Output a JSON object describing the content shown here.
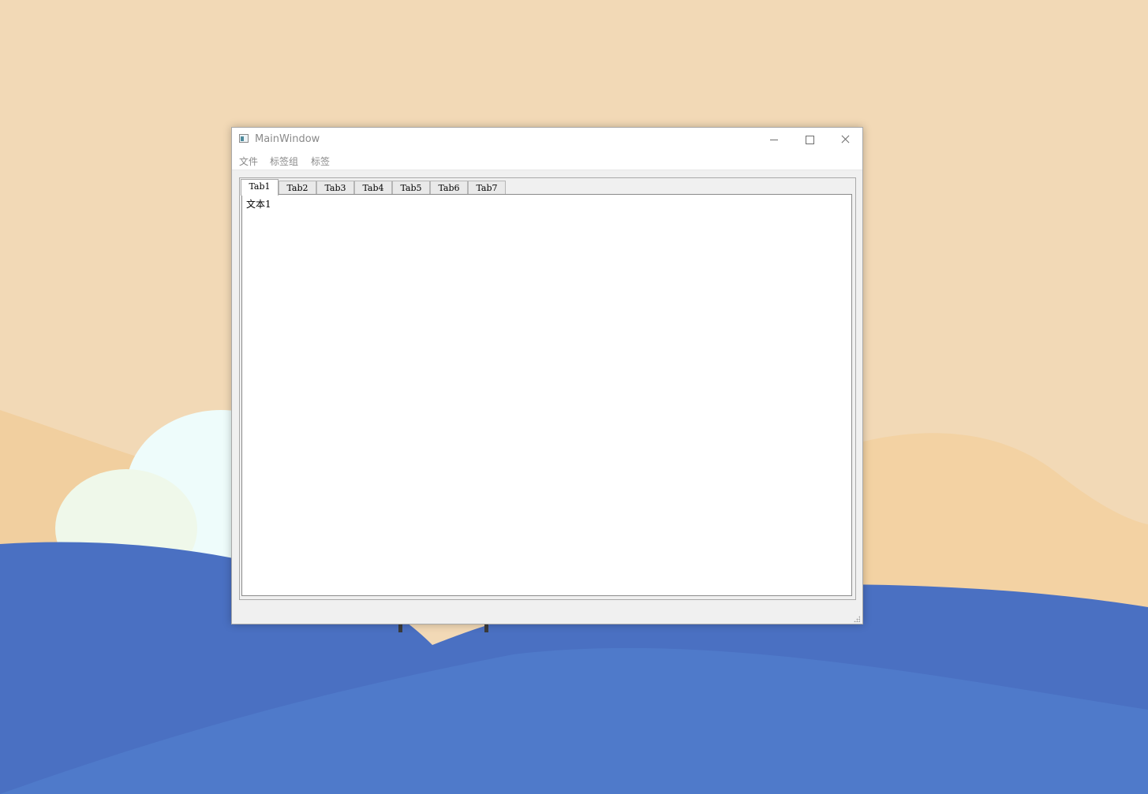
{
  "window": {
    "title": "MainWindow",
    "icon": "app-window-icon",
    "controls": [
      "minimize-icon",
      "maximize-icon",
      "close-icon"
    ]
  },
  "menubar": {
    "items": [
      {
        "label": "文件"
      },
      {
        "label": "标签组"
      },
      {
        "label": "标签"
      }
    ]
  },
  "tabs": {
    "items": [
      {
        "label": "Tab1",
        "active": true
      },
      {
        "label": "Tab2",
        "active": false
      },
      {
        "label": "Tab3",
        "active": false
      },
      {
        "label": "Tab4",
        "active": false
      },
      {
        "label": "Tab5",
        "active": false
      },
      {
        "label": "Tab6",
        "active": false
      },
      {
        "label": "Tab7",
        "active": false
      }
    ],
    "active_content": "文本1"
  },
  "colors": {
    "wallpaper_sand": "#f2d9b6",
    "wallpaper_blue": "#4a70c2",
    "window_bg": "#f0f0f0",
    "titlebar_bg": "#ffffff",
    "disabled_text": "#8a8a8a"
  }
}
